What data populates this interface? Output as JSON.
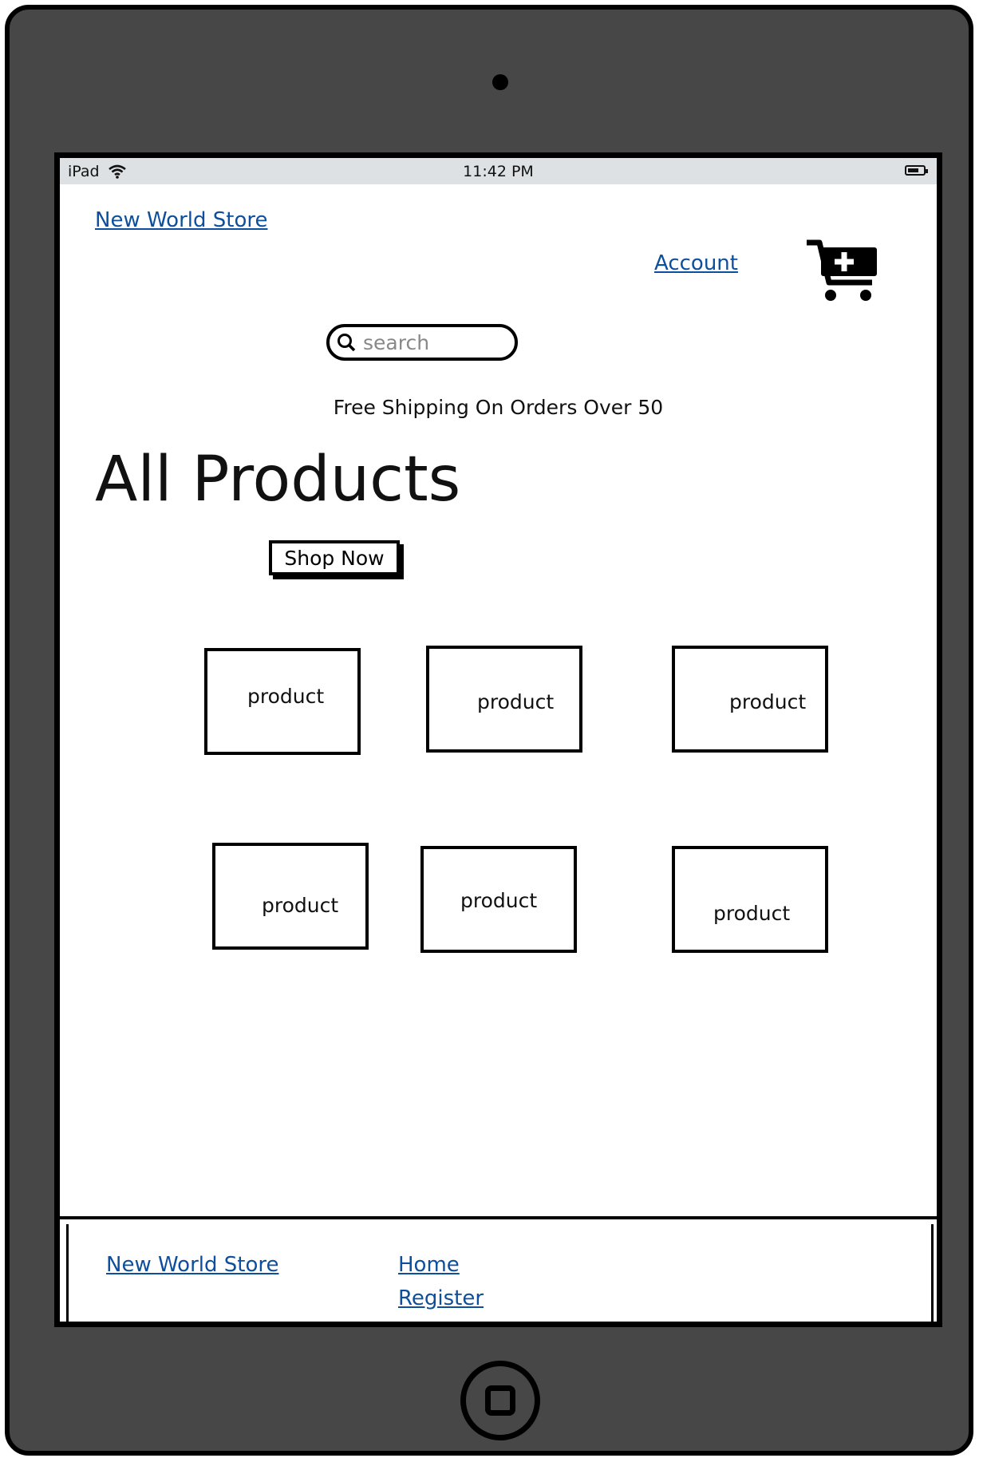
{
  "status_bar": {
    "device": "iPad",
    "time": "11:42 PM"
  },
  "header": {
    "brand": "New World Store",
    "account": "Account",
    "search_placeholder": "search"
  },
  "banner": "Free Shipping On Orders Over 50",
  "main": {
    "title": "All Products",
    "shop_now": "Shop Now",
    "products": [
      "product",
      "product",
      "product",
      "product",
      "product",
      "product"
    ]
  },
  "footer": {
    "brand": "New World Store",
    "links": [
      "Home",
      "Register"
    ]
  },
  "colors": {
    "link": "#0d4f9c",
    "device_frame": "#474747",
    "status_bar": "#dde1e4"
  }
}
